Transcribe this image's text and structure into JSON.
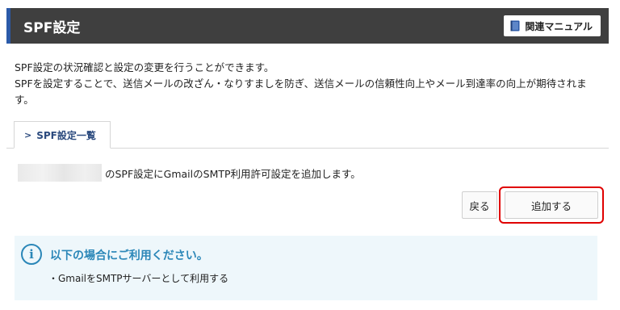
{
  "header": {
    "title": "SPF設定",
    "manual_button_label": "関連マニュアル"
  },
  "description": {
    "line1": "SPF設定の状況確認と設定の変更を行うことができます。",
    "line2": "SPFを設定することで、送信メールの改ざん・なりすましを防ぎ、送信メールの信頼性向上やメール到達率の向上が期待されます。"
  },
  "tabs": [
    {
      "label": "SPF設定一覧",
      "active": true
    }
  ],
  "message": {
    "text": "のSPF設定にGmailのSMTP利用許可設定を追加します。"
  },
  "buttons": {
    "back_label": "戻る",
    "add_label": "追加する"
  },
  "info": {
    "title": "以下の場合にご利用ください。",
    "items": [
      "・GmailをSMTPサーバーとして利用する"
    ]
  },
  "colors": {
    "header_bg": "#3f3f3f",
    "header_accent": "#2b5aa8",
    "info_bg": "#eef7fb",
    "info_accent": "#2b87b8",
    "highlight": "#e00000"
  }
}
